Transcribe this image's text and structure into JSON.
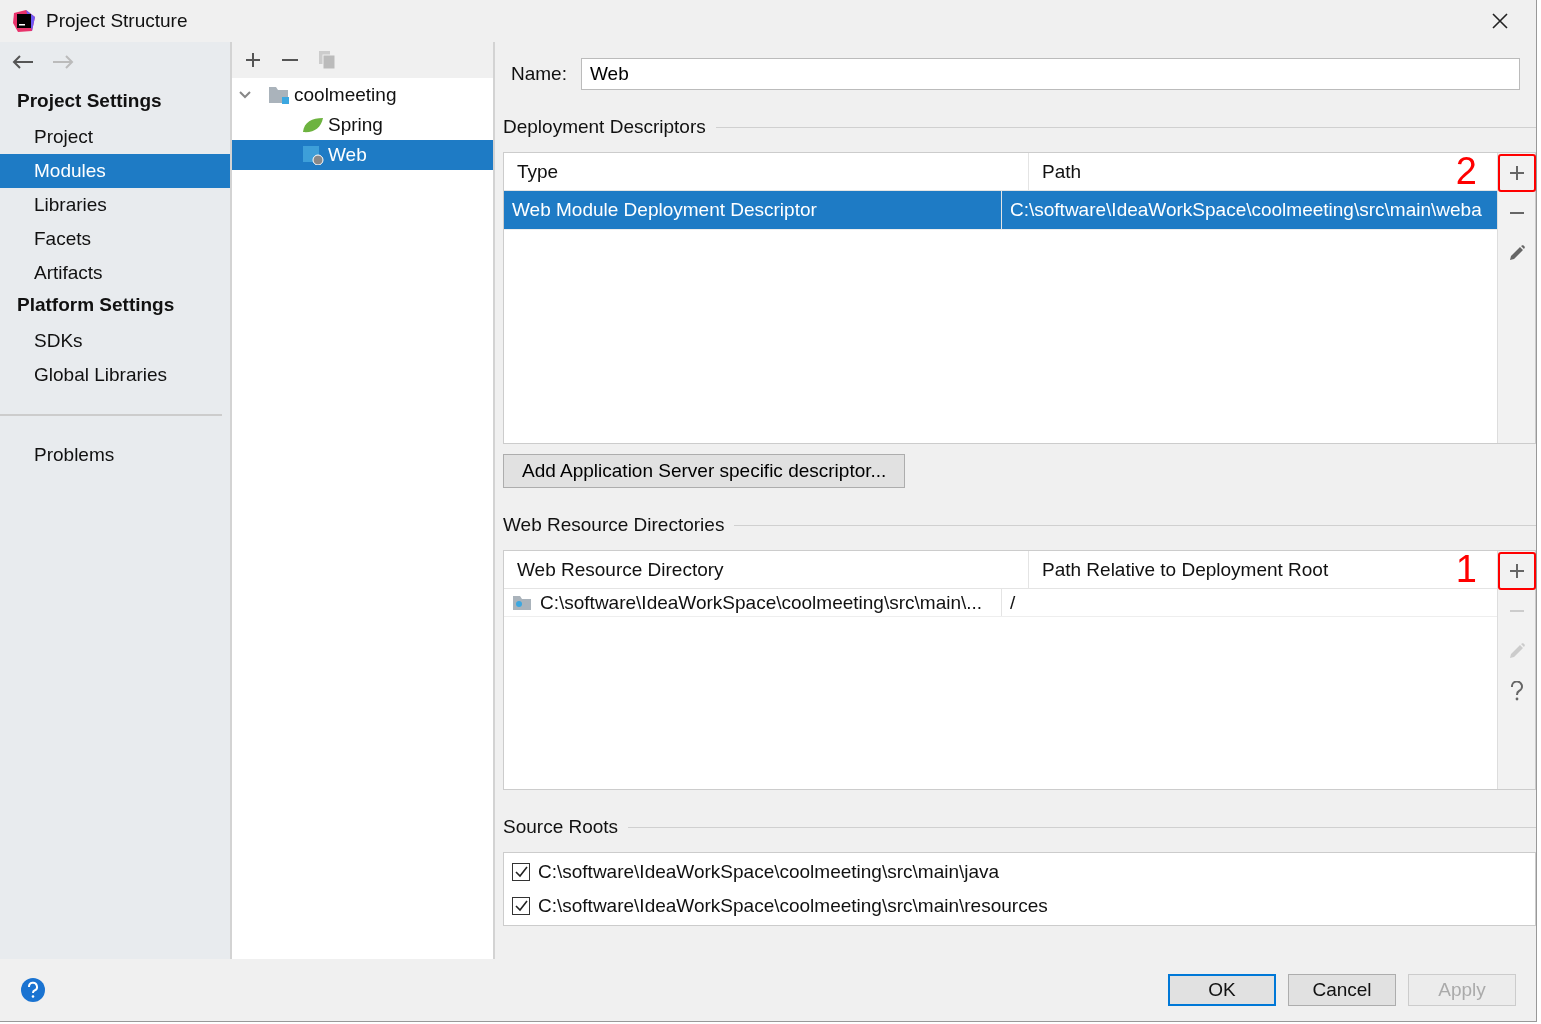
{
  "window": {
    "title": "Project Structure"
  },
  "sidebar": {
    "sections": [
      {
        "title": "Project Settings",
        "items": [
          {
            "label": "Project",
            "selected": false
          },
          {
            "label": "Modules",
            "selected": true
          },
          {
            "label": "Libraries",
            "selected": false
          },
          {
            "label": "Facets",
            "selected": false
          },
          {
            "label": "Artifacts",
            "selected": false
          }
        ]
      },
      {
        "title": "Platform Settings",
        "items": [
          {
            "label": "SDKs",
            "selected": false
          },
          {
            "label": "Global Libraries",
            "selected": false
          }
        ]
      }
    ],
    "bottom_items": [
      {
        "label": "Problems",
        "selected": false
      }
    ]
  },
  "module_tree": {
    "items": [
      {
        "label": "coolmeeting",
        "kind": "module",
        "expanded": true,
        "selected": false,
        "children": [
          {
            "label": "Spring",
            "kind": "spring",
            "selected": false
          },
          {
            "label": "Web",
            "kind": "web",
            "selected": true
          }
        ]
      }
    ]
  },
  "name_field": {
    "label": "Name:",
    "value": "Web"
  },
  "deployment_descriptors": {
    "title": "Deployment Descriptors",
    "columns": [
      "Type",
      "Path"
    ],
    "rows": [
      {
        "cells": [
          "Web Module Deployment Descriptor",
          "C:\\software\\IdeaWorkSpace\\coolmeeting\\src\\main\\weba"
        ],
        "selected": true
      }
    ],
    "tools": [
      {
        "kind": "plus",
        "disabled": false,
        "highlighted": true
      },
      {
        "kind": "minus",
        "disabled": false,
        "highlighted": false
      },
      {
        "kind": "edit",
        "disabled": false,
        "highlighted": false
      }
    ],
    "annotation": "2",
    "add_button": "Add Application Server specific descriptor..."
  },
  "web_resource_directories": {
    "title": "Web Resource Directories",
    "columns": [
      "Web Resource Directory",
      "Path Relative to Deployment Root"
    ],
    "rows": [
      {
        "cells": [
          "C:\\software\\IdeaWorkSpace\\coolmeeting\\src\\main\\...",
          "/"
        ],
        "selected": false
      }
    ],
    "tools": [
      {
        "kind": "plus",
        "disabled": false,
        "highlighted": true
      },
      {
        "kind": "minus",
        "disabled": true,
        "highlighted": false
      },
      {
        "kind": "edit",
        "disabled": true,
        "highlighted": false
      },
      {
        "kind": "help",
        "disabled": false,
        "highlighted": false
      }
    ],
    "annotation": "1"
  },
  "source_roots": {
    "title": "Source Roots",
    "items": [
      {
        "label": "C:\\software\\IdeaWorkSpace\\coolmeeting\\src\\main\\java",
        "checked": true
      },
      {
        "label": "C:\\software\\IdeaWorkSpace\\coolmeeting\\src\\main\\resources",
        "checked": true
      }
    ]
  },
  "buttons": [
    {
      "label": "OK",
      "kind": "default",
      "disabled": false
    },
    {
      "label": "Cancel",
      "kind": "normal",
      "disabled": false
    },
    {
      "label": "Apply",
      "kind": "normal",
      "disabled": true
    }
  ]
}
